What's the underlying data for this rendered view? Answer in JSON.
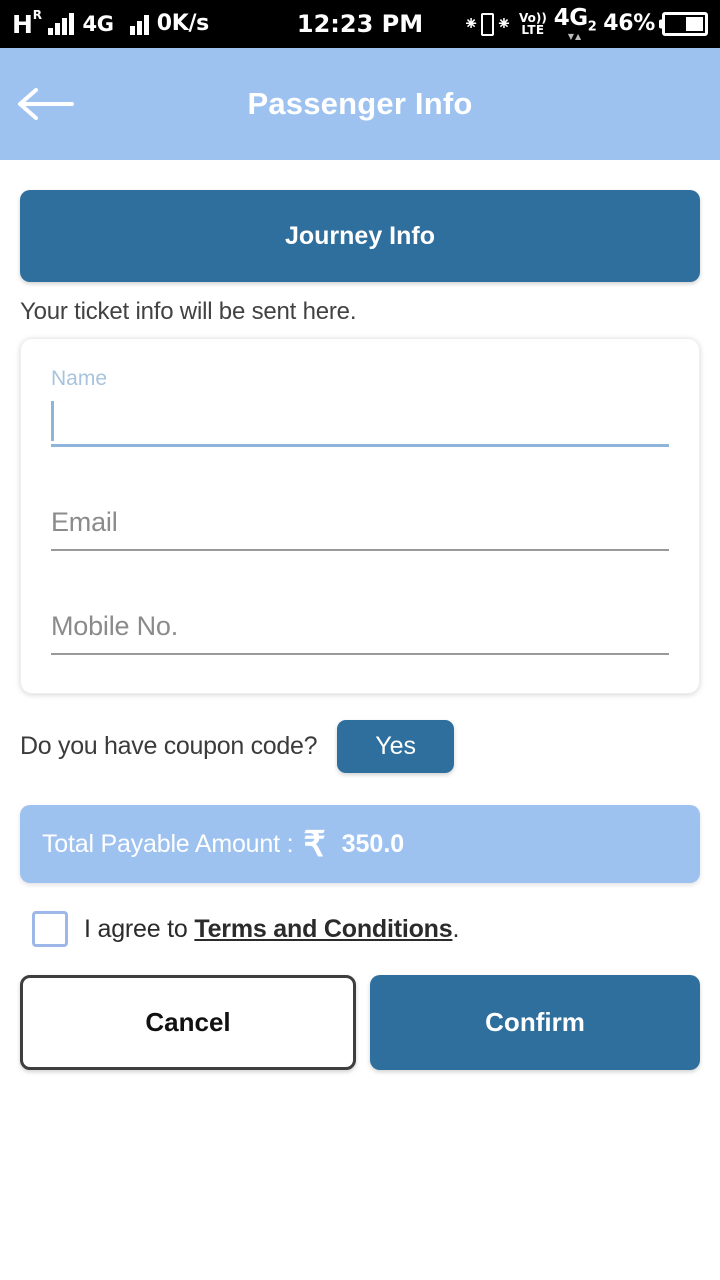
{
  "status_bar": {
    "network_letter": "H",
    "roaming_badge": "R",
    "network_type": "4G",
    "data_speed": "0K/s",
    "time": "12:23 PM",
    "volte_top": "Vo))",
    "volte_bottom": "LTE",
    "sim2_network": "4G",
    "sim2_index": "2",
    "battery_percent": "46%",
    "battery_level": 46
  },
  "app_bar": {
    "title": "Passenger Info",
    "back_icon": "arrow-left-icon",
    "background_color": "#9dc2f0"
  },
  "main": {
    "journey_info_label": "Journey Info",
    "ticket_info_note": "Your ticket info will be sent here.",
    "form": {
      "name": {
        "label": "Name",
        "value": "",
        "placeholder": "Name",
        "focused": true
      },
      "email": {
        "label": "Email",
        "value": "",
        "placeholder": "Email",
        "focused": false
      },
      "mobile": {
        "label": "Mobile No.",
        "value": "",
        "placeholder": "Mobile No.",
        "focused": false
      }
    },
    "coupon": {
      "question": "Do you have coupon code?",
      "yes_label": "Yes"
    },
    "total": {
      "label": "Total Payable Amount :",
      "currency_symbol": "₹",
      "amount": "350.0"
    },
    "terms": {
      "checked": false,
      "prefix": "I agree to ",
      "link": "Terms and Conditions",
      "suffix": "."
    },
    "actions": {
      "cancel_label": "Cancel",
      "confirm_label": "Confirm"
    }
  },
  "colors": {
    "primary_blue": "#2e6f9e",
    "light_blue": "#9dc2f0",
    "focus_blue": "#8fb4d9",
    "checkbox_border": "#9db8e8"
  }
}
